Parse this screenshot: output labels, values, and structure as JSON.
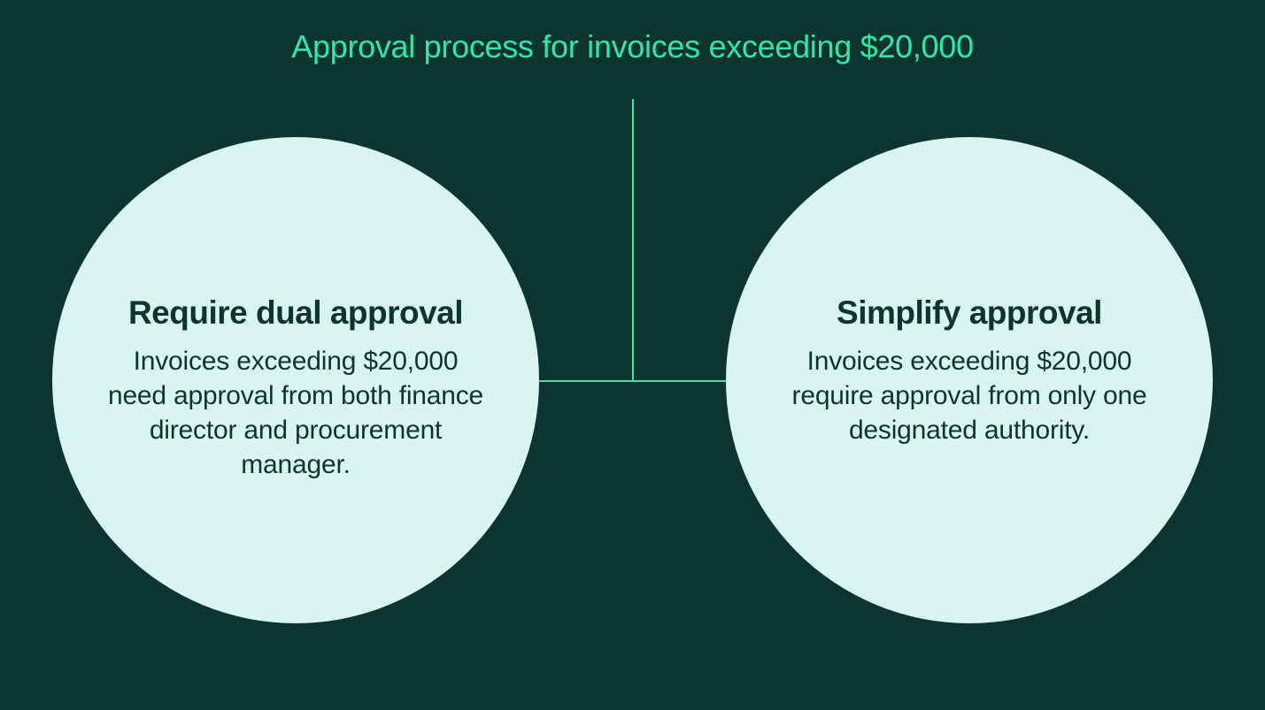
{
  "title": "Approval process for invoices exceeding $20,000",
  "options": [
    {
      "heading": "Require dual approval",
      "body": "Invoices exceeding $20,000 need approval from both finance director and procurement manager."
    },
    {
      "heading": "Simplify approval",
      "body": "Invoices exceeding $20,000 require approval from only one designated authority."
    }
  ]
}
